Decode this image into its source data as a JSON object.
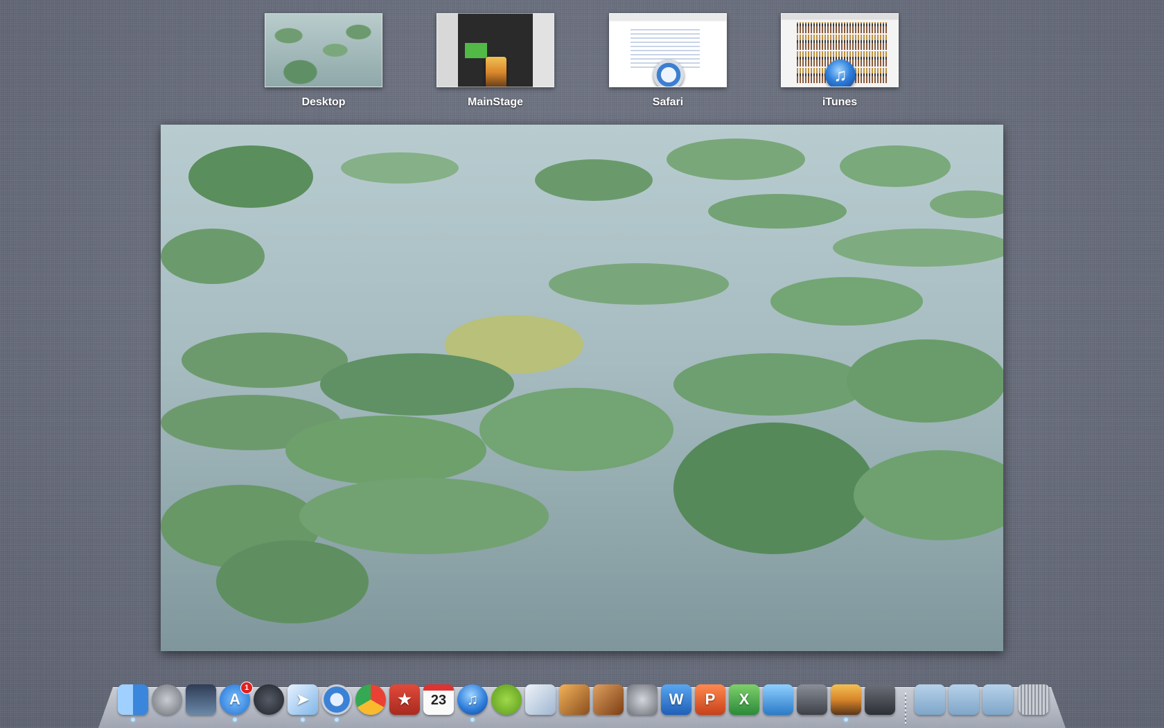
{
  "spaces": [
    {
      "label": "Desktop",
      "thumb": "desktop-thumbnail"
    },
    {
      "label": "MainStage",
      "thumb": "mainstage-window-thumbnail",
      "icon": "mainstage-icon"
    },
    {
      "label": "Safari",
      "thumb": "safari-window-thumbnail",
      "icon": "safari-compass-icon"
    },
    {
      "label": "iTunes",
      "thumb": "itunes-window-thumbnail",
      "icon": "itunes-note-icon"
    }
  ],
  "desktop_preview": {
    "wallpaper": "lily-pads-on-water"
  },
  "dock": {
    "apps": [
      {
        "name": "Finder",
        "icon": "finder-icon",
        "color": "#5aa9f0",
        "running": true
      },
      {
        "name": "Launchpad",
        "icon": "rocket-icon",
        "color": "#8c8f96",
        "running": false
      },
      {
        "name": "Mission Control",
        "icon": "mission-control-icon",
        "color": "#4d6b8a",
        "running": false
      },
      {
        "name": "App Store",
        "icon": "app-store-icon",
        "color": "#2c8ae8",
        "running": true,
        "badge": "1"
      },
      {
        "name": "Dashboard",
        "icon": "dashboard-icon",
        "color": "#333842",
        "running": false
      },
      {
        "name": "Mail",
        "icon": "mail-icon",
        "color": "#7fb7e8",
        "running": true
      },
      {
        "name": "Safari",
        "icon": "safari-icon",
        "color": "#3b82d6",
        "running": true
      },
      {
        "name": "Google Chrome",
        "icon": "chrome-icon",
        "color": "#e94235",
        "running": false
      },
      {
        "name": "Wunderlist",
        "icon": "wunderlist-icon",
        "color": "#c8352a",
        "running": false
      },
      {
        "name": "iCal",
        "icon": "calendar-icon",
        "color": "#f3f3f3",
        "running": false,
        "day": "23"
      },
      {
        "name": "iTunes",
        "icon": "itunes-icon",
        "color": "#3a86e0",
        "running": true
      },
      {
        "name": "Spotify",
        "icon": "spotify-icon",
        "color": "#7cbf2c",
        "running": false
      },
      {
        "name": "Preview",
        "icon": "preview-icon",
        "color": "#c9d6e6",
        "running": false
      },
      {
        "name": "iPhoto",
        "icon": "iphoto-icon",
        "color": "#d9873a",
        "running": false
      },
      {
        "name": "GarageBand",
        "icon": "garageband-icon",
        "color": "#b56a2a",
        "running": false
      },
      {
        "name": "System Preferences",
        "icon": "system-preferences-icon",
        "color": "#8e9198",
        "running": false
      },
      {
        "name": "Word",
        "icon": "word-icon",
        "color": "#2b76d2",
        "running": false
      },
      {
        "name": "PowerPoint",
        "icon": "powerpoint-icon",
        "color": "#e0522a",
        "running": false
      },
      {
        "name": "Excel",
        "icon": "excel-icon",
        "color": "#3aa64a",
        "running": false
      },
      {
        "name": "Messenger",
        "icon": "messenger-icon",
        "color": "#3c9be0",
        "running": false
      },
      {
        "name": "FaceTime",
        "icon": "facetime-icon",
        "color": "#5a5f68",
        "running": false
      },
      {
        "name": "MainStage",
        "icon": "mainstage-icon",
        "color": "#d8862a",
        "running": true
      },
      {
        "name": "Disk Utility",
        "icon": "disk-utility-icon",
        "color": "#4a4d55",
        "running": false
      }
    ],
    "stacks": [
      {
        "name": "Applications",
        "icon": "applications-folder-icon",
        "color": "#8eb6d8"
      },
      {
        "name": "Downloads",
        "icon": "downloads-folder-icon",
        "color": "#8eb6d8"
      },
      {
        "name": "Documents",
        "icon": "documents-folder-icon",
        "color": "#8eb6d8"
      },
      {
        "name": "Trash",
        "icon": "trash-icon",
        "color": "#9aa0a8"
      }
    ]
  }
}
